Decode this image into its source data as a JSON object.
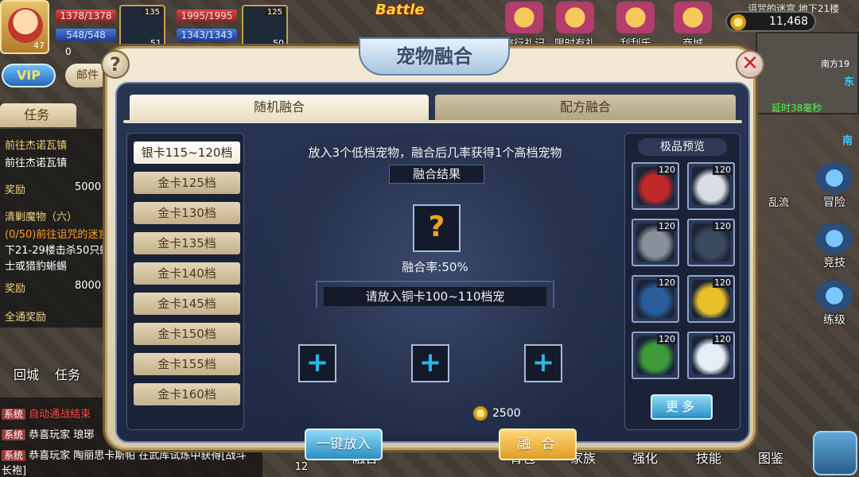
{
  "hud": {
    "hero_level": "47",
    "hp": "1378/1378",
    "mp": "548/548",
    "coins": "0",
    "pet_level": "135",
    "pet_num": "51",
    "pet_hp": "1995/1995",
    "pet_mp": "1343/1343",
    "pet2_level": "125",
    "pet2_num": "50",
    "vip": "VIP",
    "mail": "邮件",
    "battle": "Battle",
    "gold": "11,468",
    "top_icons": [
      "旅行礼记",
      "限时有礼",
      "刮刮乐",
      "商城"
    ],
    "minimap_title": "诅咒的迷宫 地下21楼",
    "minimap_coord": "南方19",
    "minimap_east": "东",
    "minimap_south": "南",
    "latency": "延时38毫秒"
  },
  "task_panel": {
    "tab": "任务",
    "lines": [
      {
        "text": "前往杰诺瓦镇",
        "cls": "c-yellow"
      },
      {
        "text": "前往杰诺瓦镇",
        "cls": "c-white"
      },
      {
        "text": "奖励",
        "cls": "c-yellow"
      },
      {
        "text": "5000",
        "cls": "c-white"
      },
      {
        "text": "清剿魔物（六）",
        "cls": "c-yellow"
      },
      {
        "text": "(0/50)前往诅咒的迷宫",
        "cls": "c-orange"
      },
      {
        "text": "下21-29楼击杀50只蝴",
        "cls": "c-white"
      },
      {
        "text": "士或猎豹蜥蜴",
        "cls": "c-white"
      },
      {
        "text": "奖励",
        "cls": "c-yellow"
      },
      {
        "text": "8000",
        "cls": "c-white"
      },
      {
        "text": "全通奖励",
        "cls": "c-yellow"
      }
    ]
  },
  "chat": [
    {
      "tag": "系统",
      "text": "自动通战结束"
    },
    {
      "tag": "系统",
      "text": "恭喜玩家 琅琊"
    },
    {
      "tag": "系统",
      "text": "恭喜玩家 陶丽思卡斯帕 在武库试炼中获得[战斗长袍]"
    }
  ],
  "bottom_bar": [
    "回城",
    "任务",
    "背包",
    "家族",
    "强化",
    "技能",
    "图鉴"
  ],
  "bottom_extra": {
    "fuse": "融合",
    "num": "12"
  },
  "side_buttons": [
    "冒险",
    "竞技",
    "练级"
  ],
  "side_label": "乱流",
  "modal": {
    "title": "宠物融合",
    "help": "?",
    "close": "✕",
    "tabs": {
      "random": "随机融合",
      "recipe": "配方融合"
    },
    "grades": [
      "银卡115~120档",
      "金卡125档",
      "金卡130档",
      "金卡135档",
      "金卡140档",
      "金卡145档",
      "金卡150档",
      "金卡155档",
      "金卡160档"
    ],
    "hint": "放入3个低档宠物，融合后几率获得1个高档宠物",
    "result_label": "融合结果",
    "result_mark": "?",
    "rate": "融合率:50%",
    "need": "请放入铜卡100~110档宠",
    "add": "+",
    "cost": "2500",
    "put_all": "一键放入",
    "fuse": "融 合",
    "preview_title": "极品预览",
    "preview_level": "120",
    "preview_pets": [
      {
        "name": "red-dragon",
        "color": "#c0282a"
      },
      {
        "name": "white-beast",
        "color": "#d9dde4"
      },
      {
        "name": "grey-crawler",
        "color": "#8a9099"
      },
      {
        "name": "dark-bird",
        "color": "#3b4a5e"
      },
      {
        "name": "blue-golem",
        "color": "#2a5d9a"
      },
      {
        "name": "yellow-spider",
        "color": "#e8c12a"
      },
      {
        "name": "green-cactus",
        "color": "#3e9a3a"
      },
      {
        "name": "white-blade",
        "color": "#e3eef6"
      }
    ],
    "more": "更多"
  },
  "colors": {
    "accent_gold": "#f1a21a",
    "accent_blue": "#2bb6e8",
    "modal_bg": "#283654"
  }
}
